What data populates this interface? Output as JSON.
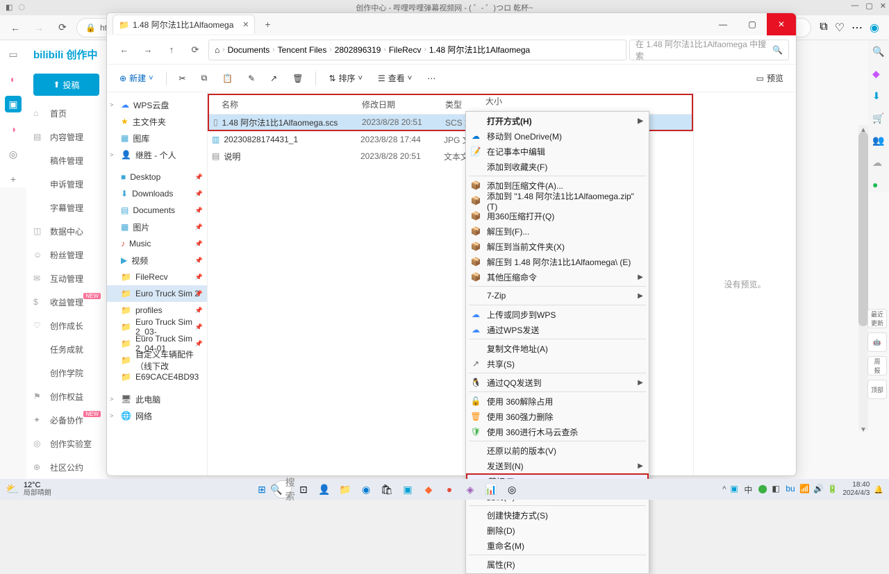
{
  "browser": {
    "title": "创作中心 - 哔哩哔哩弹幕视频网 - ( ゜- ゜)つロ 乾杯~",
    "url": "https://创作中"
  },
  "bilibili": {
    "logo": "bilibili 创作中",
    "upload": "投稿",
    "nav": [
      {
        "icon": "⌂",
        "label": "首页"
      },
      {
        "icon": "▤",
        "label": "内容管理"
      },
      {
        "icon": "",
        "label": "稿件管理"
      },
      {
        "icon": "",
        "label": "申诉管理"
      },
      {
        "icon": "",
        "label": "字幕管理"
      },
      {
        "icon": "◫",
        "label": "数据中心"
      },
      {
        "icon": "☺",
        "label": "粉丝管理"
      },
      {
        "icon": "✉",
        "label": "互动管理"
      },
      {
        "icon": "$",
        "label": "收益管理",
        "badge": "NEW"
      },
      {
        "icon": "♡",
        "label": "创作成长"
      },
      {
        "icon": "",
        "label": "任务成就"
      },
      {
        "icon": "",
        "label": "创作学院"
      },
      {
        "icon": "⚑",
        "label": "创作权益"
      },
      {
        "icon": "✦",
        "label": "必备协作",
        "badge": "NEW"
      },
      {
        "icon": "◎",
        "label": "创作实验室"
      },
      {
        "icon": "⊕",
        "label": "社区公约"
      }
    ]
  },
  "explorer": {
    "tab": "1.48 阿尔法1比1Alfaomega",
    "breadcrumb": [
      "Documents",
      "Tencent Files",
      "2802896319",
      "FileRecv",
      "1.48 阿尔法1比1Alfaomega"
    ],
    "search_placeholder": "在 1.48 阿尔法1比1Alfaomega 中搜索",
    "toolbar": {
      "new": "新建",
      "sort": "排序",
      "view": "查看",
      "preview": "预览"
    },
    "sidebar": {
      "groups": [
        {
          "items": [
            {
              "icon": "☁",
              "label": "WPS云盘",
              "chev": ">",
              "color": "#3d8bff"
            },
            {
              "icon": "★",
              "label": "主文件夹",
              "color": "#f7b500"
            },
            {
              "icon": "▦",
              "label": "图库",
              "color": "#3fa7d6"
            },
            {
              "icon": "👤",
              "label": "继胜 - 个人",
              "chev": ">",
              "color": "#3d8bff"
            }
          ]
        },
        {
          "items": [
            {
              "icon": "■",
              "label": "Desktop",
              "pin": true,
              "color": "#3fa7d6"
            },
            {
              "icon": "⬇",
              "label": "Downloads",
              "pin": true,
              "color": "#3fa7d6"
            },
            {
              "icon": "▤",
              "label": "Documents",
              "pin": true,
              "color": "#3fa7d6"
            },
            {
              "icon": "▦",
              "label": "图片",
              "pin": true,
              "color": "#3fa7d6"
            },
            {
              "icon": "♪",
              "label": "Music",
              "pin": true,
              "color": "#e74c3c"
            },
            {
              "icon": "▶",
              "label": "视频",
              "pin": true,
              "color": "#3fa7d6"
            },
            {
              "icon": "📁",
              "label": "FileRecv",
              "pin": true,
              "color": "#fdb93b"
            },
            {
              "icon": "📁",
              "label": "Euro Truck Sim 2",
              "pin": true,
              "sel": true,
              "color": "#fdb93b"
            },
            {
              "icon": "📁",
              "label": "profiles",
              "pin": true,
              "color": "#fdb93b"
            },
            {
              "icon": "📁",
              "label": "Euro Truck Sim 2_03-",
              "pin": true,
              "color": "#fdb93b"
            },
            {
              "icon": "📁",
              "label": "Euro Truck Sim 2_04-01",
              "pin": true,
              "color": "#fdb93b"
            },
            {
              "icon": "📁",
              "label": "自定义车辆配件（线下改",
              "color": "#fdb93b"
            },
            {
              "icon": "📁",
              "label": "E69CACE4BD93",
              "color": "#fdb93b"
            }
          ]
        },
        {
          "items": [
            {
              "icon": "🖥",
              "label": "此电脑",
              "chev": ">"
            },
            {
              "icon": "🌐",
              "label": "网络",
              "chev": ">"
            }
          ]
        }
      ]
    },
    "columns": {
      "name": "名称",
      "date": "修改日期",
      "type": "类型",
      "size": "大小"
    },
    "files": [
      {
        "icon": "▯",
        "name": "1.48 阿尔法1比1Alfaomega.scs",
        "date": "2023/8/28 20:51",
        "type": "SCS 文",
        "sel": true,
        "hl": true
      },
      {
        "icon": "▥",
        "name": "20230828174431_1",
        "date": "2023/8/28 17:44",
        "type": "JPG 文",
        "iconcolor": "#3fa7d6"
      },
      {
        "icon": "▤",
        "name": "说明",
        "date": "2023/8/28 20:51",
        "type": "文本文"
      }
    ],
    "preview_text": "没有预览。"
  },
  "context_menu": {
    "items": [
      {
        "label": "打开方式(H)",
        "bold": true,
        "arrow": true
      },
      {
        "icon": "☁",
        "label": "移动到 OneDrive(M)",
        "iconcolor": "#0078d4"
      },
      {
        "icon": "📝",
        "label": "在记事本中编辑"
      },
      {
        "label": "添加到收藏夹(F)"
      },
      {
        "sep": true
      },
      {
        "icon": "📦",
        "label": "添加到压缩文件(A)...",
        "iconcolor": "#d8bb6e"
      },
      {
        "icon": "📦",
        "label": "添加到 \"1.48 阿尔法1比1Alfaomega.zip\" (T)",
        "iconcolor": "#d8bb6e"
      },
      {
        "icon": "📦",
        "label": "用360压缩打开(Q)",
        "iconcolor": "#d8bb6e"
      },
      {
        "icon": "📦",
        "label": "解压到(F)...",
        "iconcolor": "#d8bb6e"
      },
      {
        "icon": "📦",
        "label": "解压到当前文件夹(X)",
        "iconcolor": "#d8bb6e"
      },
      {
        "icon": "📦",
        "label": "解压到 1.48 阿尔法1比1Alfaomega\\ (E)",
        "iconcolor": "#d8bb6e"
      },
      {
        "icon": "📦",
        "label": "其他压缩命令",
        "arrow": true,
        "iconcolor": "#d8bb6e"
      },
      {
        "sep": true
      },
      {
        "label": "7-Zip",
        "arrow": true
      },
      {
        "sep": true
      },
      {
        "icon": "☁",
        "label": "上传或同步到WPS",
        "iconcolor": "#3d8bff"
      },
      {
        "icon": "☁",
        "label": "通过WPS发送",
        "iconcolor": "#3d8bff"
      },
      {
        "sep": true
      },
      {
        "label": "复制文件地址(A)"
      },
      {
        "icon": "↗",
        "label": "共享(S)"
      },
      {
        "sep": true
      },
      {
        "icon": "🐧",
        "label": "通过QQ发送到",
        "arrow": true
      },
      {
        "sep": true
      },
      {
        "icon": "🔓",
        "label": "使用 360解除占用",
        "iconcolor": "#ff8c00"
      },
      {
        "icon": "🗑",
        "label": "使用 360强力删除",
        "iconcolor": "#ff8c00"
      },
      {
        "icon": "🛡",
        "label": "使用 360进行木马云查杀",
        "iconcolor": "#3cb043"
      },
      {
        "sep": true
      },
      {
        "label": "还原以前的版本(V)"
      },
      {
        "label": "发送到(N)",
        "arrow": true
      },
      {
        "label": "剪切(T)",
        "hl": true
      },
      {
        "label": "复制(C)"
      },
      {
        "sep": true
      },
      {
        "label": "创建快捷方式(S)"
      },
      {
        "label": "删除(D)"
      },
      {
        "label": "重命名(M)"
      },
      {
        "sep": true
      },
      {
        "label": "属性(R)"
      }
    ]
  },
  "taskbar": {
    "weather_temp": "12°C",
    "weather_desc": "局部晴朗",
    "search": "搜索",
    "time": "18:40",
    "date": "2024/4/3"
  }
}
